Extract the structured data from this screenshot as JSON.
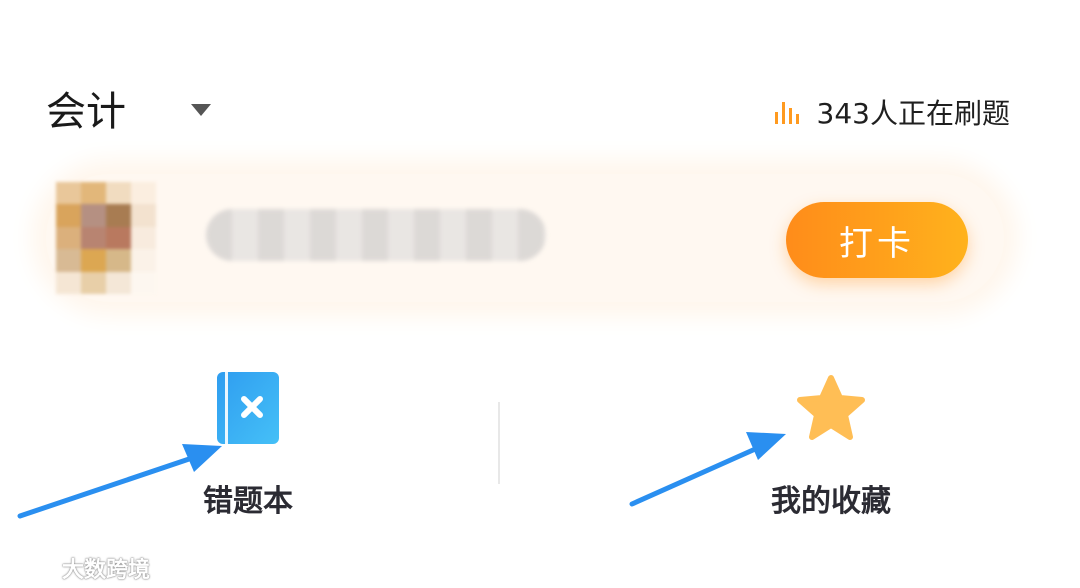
{
  "header": {
    "subject": "会计",
    "active_count_text": "343人正在刷题",
    "stats_icon": "bar-chart-icon",
    "accent_color": "#ff9a1f"
  },
  "card": {
    "checkin_label": "打卡",
    "avatar_blurred": true,
    "name_blurred": true
  },
  "features": [
    {
      "label": "错题本",
      "icon": "wrong-notebook-icon",
      "color": "#35a8f0"
    },
    {
      "label": "我的收藏",
      "icon": "star-icon",
      "color": "#ffb84a"
    }
  ],
  "watermark": {
    "text": "大数跨境"
  }
}
